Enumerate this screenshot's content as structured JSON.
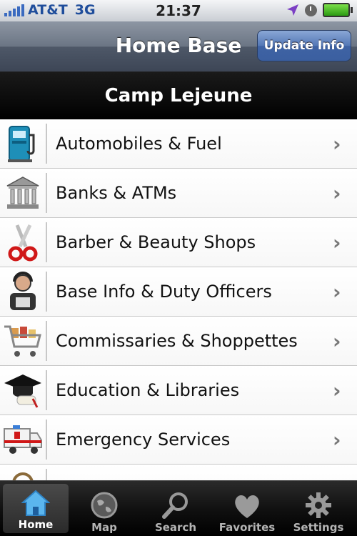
{
  "status": {
    "carrier": "AT&T",
    "network": "3G",
    "time": "21:37"
  },
  "nav": {
    "title": "Home Base",
    "update_label": "Update Info"
  },
  "section": {
    "title": "Camp Lejeune"
  },
  "list": [
    {
      "label": "Automobiles & Fuel",
      "icon": "fuel-pump-icon"
    },
    {
      "label": "Banks & ATMs",
      "icon": "bank-icon"
    },
    {
      "label": "Barber & Beauty Shops",
      "icon": "scissors-icon"
    },
    {
      "label": "Base Info & Duty Officers",
      "icon": "operator-icon"
    },
    {
      "label": "Commissaries & Shoppettes",
      "icon": "shopping-cart-icon"
    },
    {
      "label": "Education & Libraries",
      "icon": "graduation-cap-icon"
    },
    {
      "label": "Emergency Services",
      "icon": "ambulance-icon"
    }
  ],
  "tabs": [
    {
      "label": "Home",
      "icon": "home-icon",
      "active": true
    },
    {
      "label": "Map",
      "icon": "globe-icon"
    },
    {
      "label": "Search",
      "icon": "magnifier-icon"
    },
    {
      "label": "Favorites",
      "icon": "heart-icon"
    },
    {
      "label": "Settings",
      "icon": "gear-icon"
    }
  ],
  "colors": {
    "nav_button": "#4a6db0",
    "section_bg": "#000000",
    "tab_active": "#3a3a3a"
  }
}
